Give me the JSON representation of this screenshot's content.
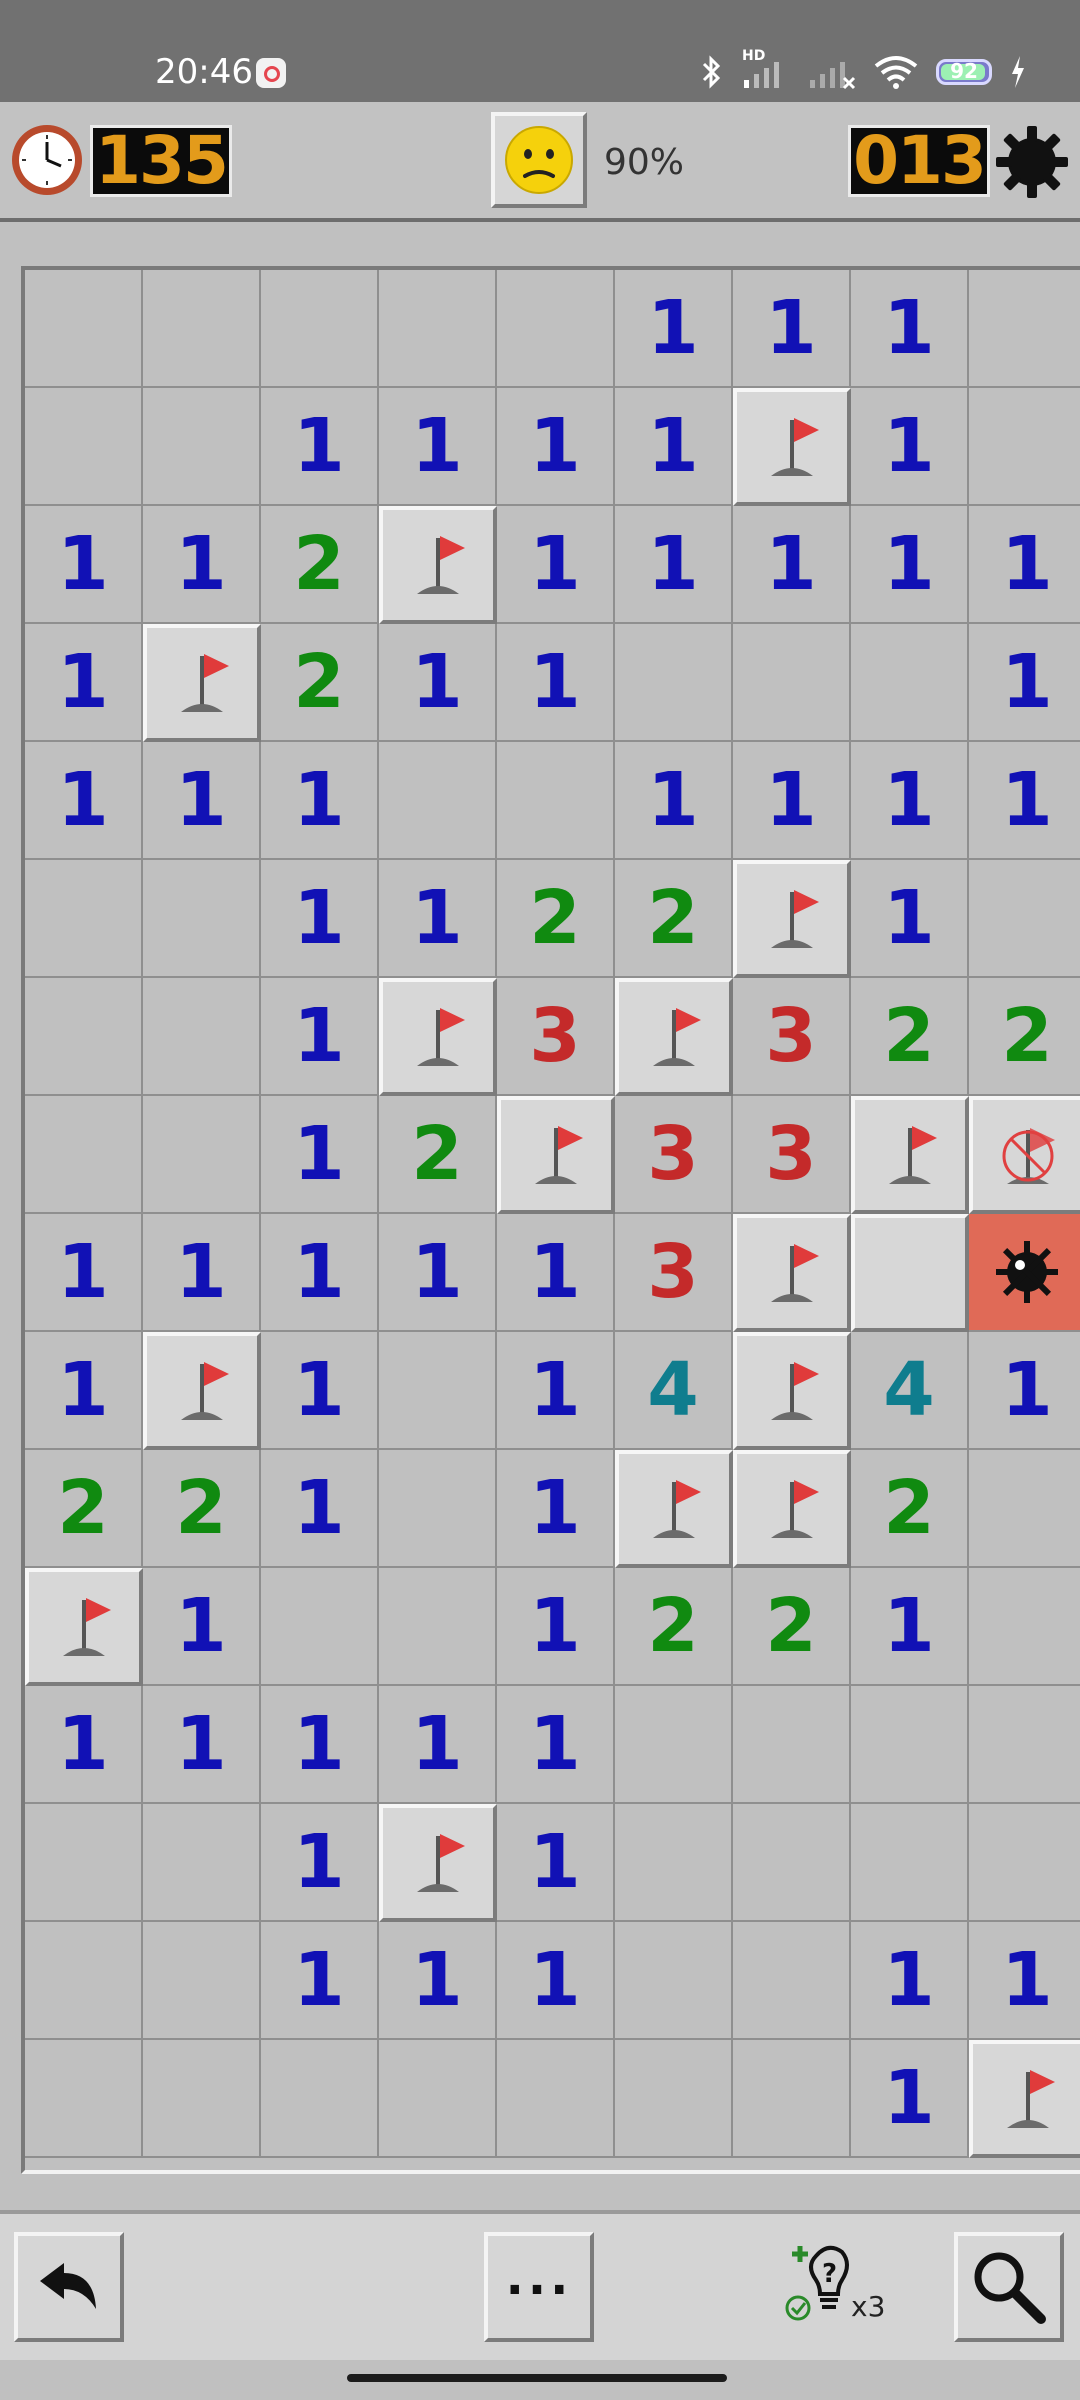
{
  "status_bar": {
    "time": "20:46",
    "network_label": "HD",
    "battery": "92"
  },
  "header": {
    "timer": "135",
    "progress": "90%",
    "mines_left": "013",
    "face": "worried-face-icon"
  },
  "board": {
    "cols": 9,
    "visible_rows": 16,
    "rows": [
      [
        "",
        "",
        "",
        "",
        "",
        "1",
        "1",
        "1",
        ""
      ],
      [
        "",
        "",
        "1",
        "1",
        "1",
        "1",
        "F",
        "1",
        ""
      ],
      [
        "1",
        "1",
        "2",
        "F",
        "1",
        "1",
        "1",
        "1",
        "1"
      ],
      [
        "1",
        "F",
        "2",
        "1",
        "1",
        "",
        "",
        "",
        "1"
      ],
      [
        "1",
        "1",
        "1",
        "",
        "",
        "1",
        "1",
        "1",
        "1"
      ],
      [
        "",
        "",
        "1",
        "1",
        "2",
        "2",
        "F",
        "1",
        ""
      ],
      [
        "",
        "",
        "1",
        "F",
        "3",
        "F",
        "3",
        "2",
        "2"
      ],
      [
        "",
        "",
        "1",
        "2",
        "F",
        "3",
        "3",
        "F",
        "X"
      ],
      [
        "1",
        "1",
        "1",
        "1",
        "1",
        "3",
        "F",
        "U",
        "M"
      ],
      [
        "1",
        "F",
        "1",
        "",
        "1",
        "4",
        "F",
        "4",
        "1"
      ],
      [
        "2",
        "2",
        "1",
        "",
        "1",
        "F",
        "F",
        "2",
        ""
      ],
      [
        "F",
        "1",
        "",
        "",
        "1",
        "2",
        "2",
        "1",
        ""
      ],
      [
        "1",
        "1",
        "1",
        "1",
        "1",
        "",
        "",
        "",
        ""
      ],
      [
        "",
        "",
        "1",
        "F",
        "1",
        "",
        "",
        "",
        ""
      ],
      [
        "",
        "",
        "1",
        "1",
        "1",
        "",
        "",
        "1",
        "1"
      ],
      [
        "",
        "",
        "",
        "",
        "",
        "",
        "",
        "1",
        "F"
      ]
    ],
    "legend": {
      "F": "flag",
      "X": "wrong-flag",
      "M": "exploded-mine",
      "U": "unrevealed"
    }
  },
  "toolbar": {
    "undo_icon": "undo-arrow-icon",
    "more_label": "...",
    "hint_count": "x3",
    "search_icon": "magnifier-icon"
  }
}
